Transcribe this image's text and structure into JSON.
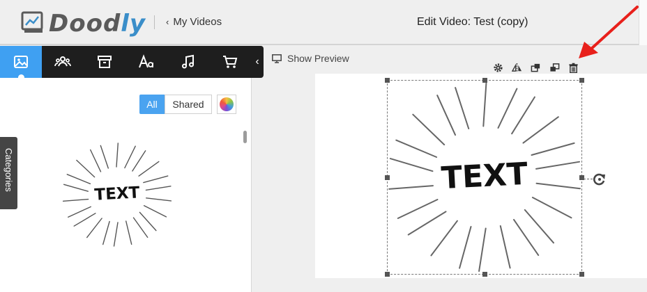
{
  "header": {
    "logo_text_a": "Dood",
    "logo_text_b": "ly",
    "back_label": "My Videos",
    "page_title": "Edit Video: Test (copy)"
  },
  "toolbar": {
    "tools": [
      {
        "name": "images-tab",
        "icon": "image-icon",
        "active": true
      },
      {
        "name": "characters-tab",
        "icon": "people-icon",
        "active": false
      },
      {
        "name": "props-tab",
        "icon": "box-icon",
        "active": false
      },
      {
        "name": "text-tab",
        "icon": "font-icon",
        "active": false
      },
      {
        "name": "music-tab",
        "icon": "music-note-icon",
        "active": false
      },
      {
        "name": "store-tab",
        "icon": "cart-icon",
        "active": false
      }
    ],
    "collapse_icon": "chevron-left-icon"
  },
  "filters": {
    "all_label": "All",
    "shared_label": "Shared"
  },
  "categories_label": "Categories",
  "asset": {
    "text": "TEXT"
  },
  "preview": {
    "show_preview_label": "Show Preview",
    "object_tools": [
      "gear-icon",
      "flip-icon",
      "bring-front-icon",
      "send-back-icon",
      "trash-icon"
    ]
  },
  "canvas_object": {
    "text": "TEXT"
  },
  "colors": {
    "accent": "#3fa0f2",
    "toolbar_bg": "#1e1e1e",
    "arrow": "#e8201b"
  }
}
